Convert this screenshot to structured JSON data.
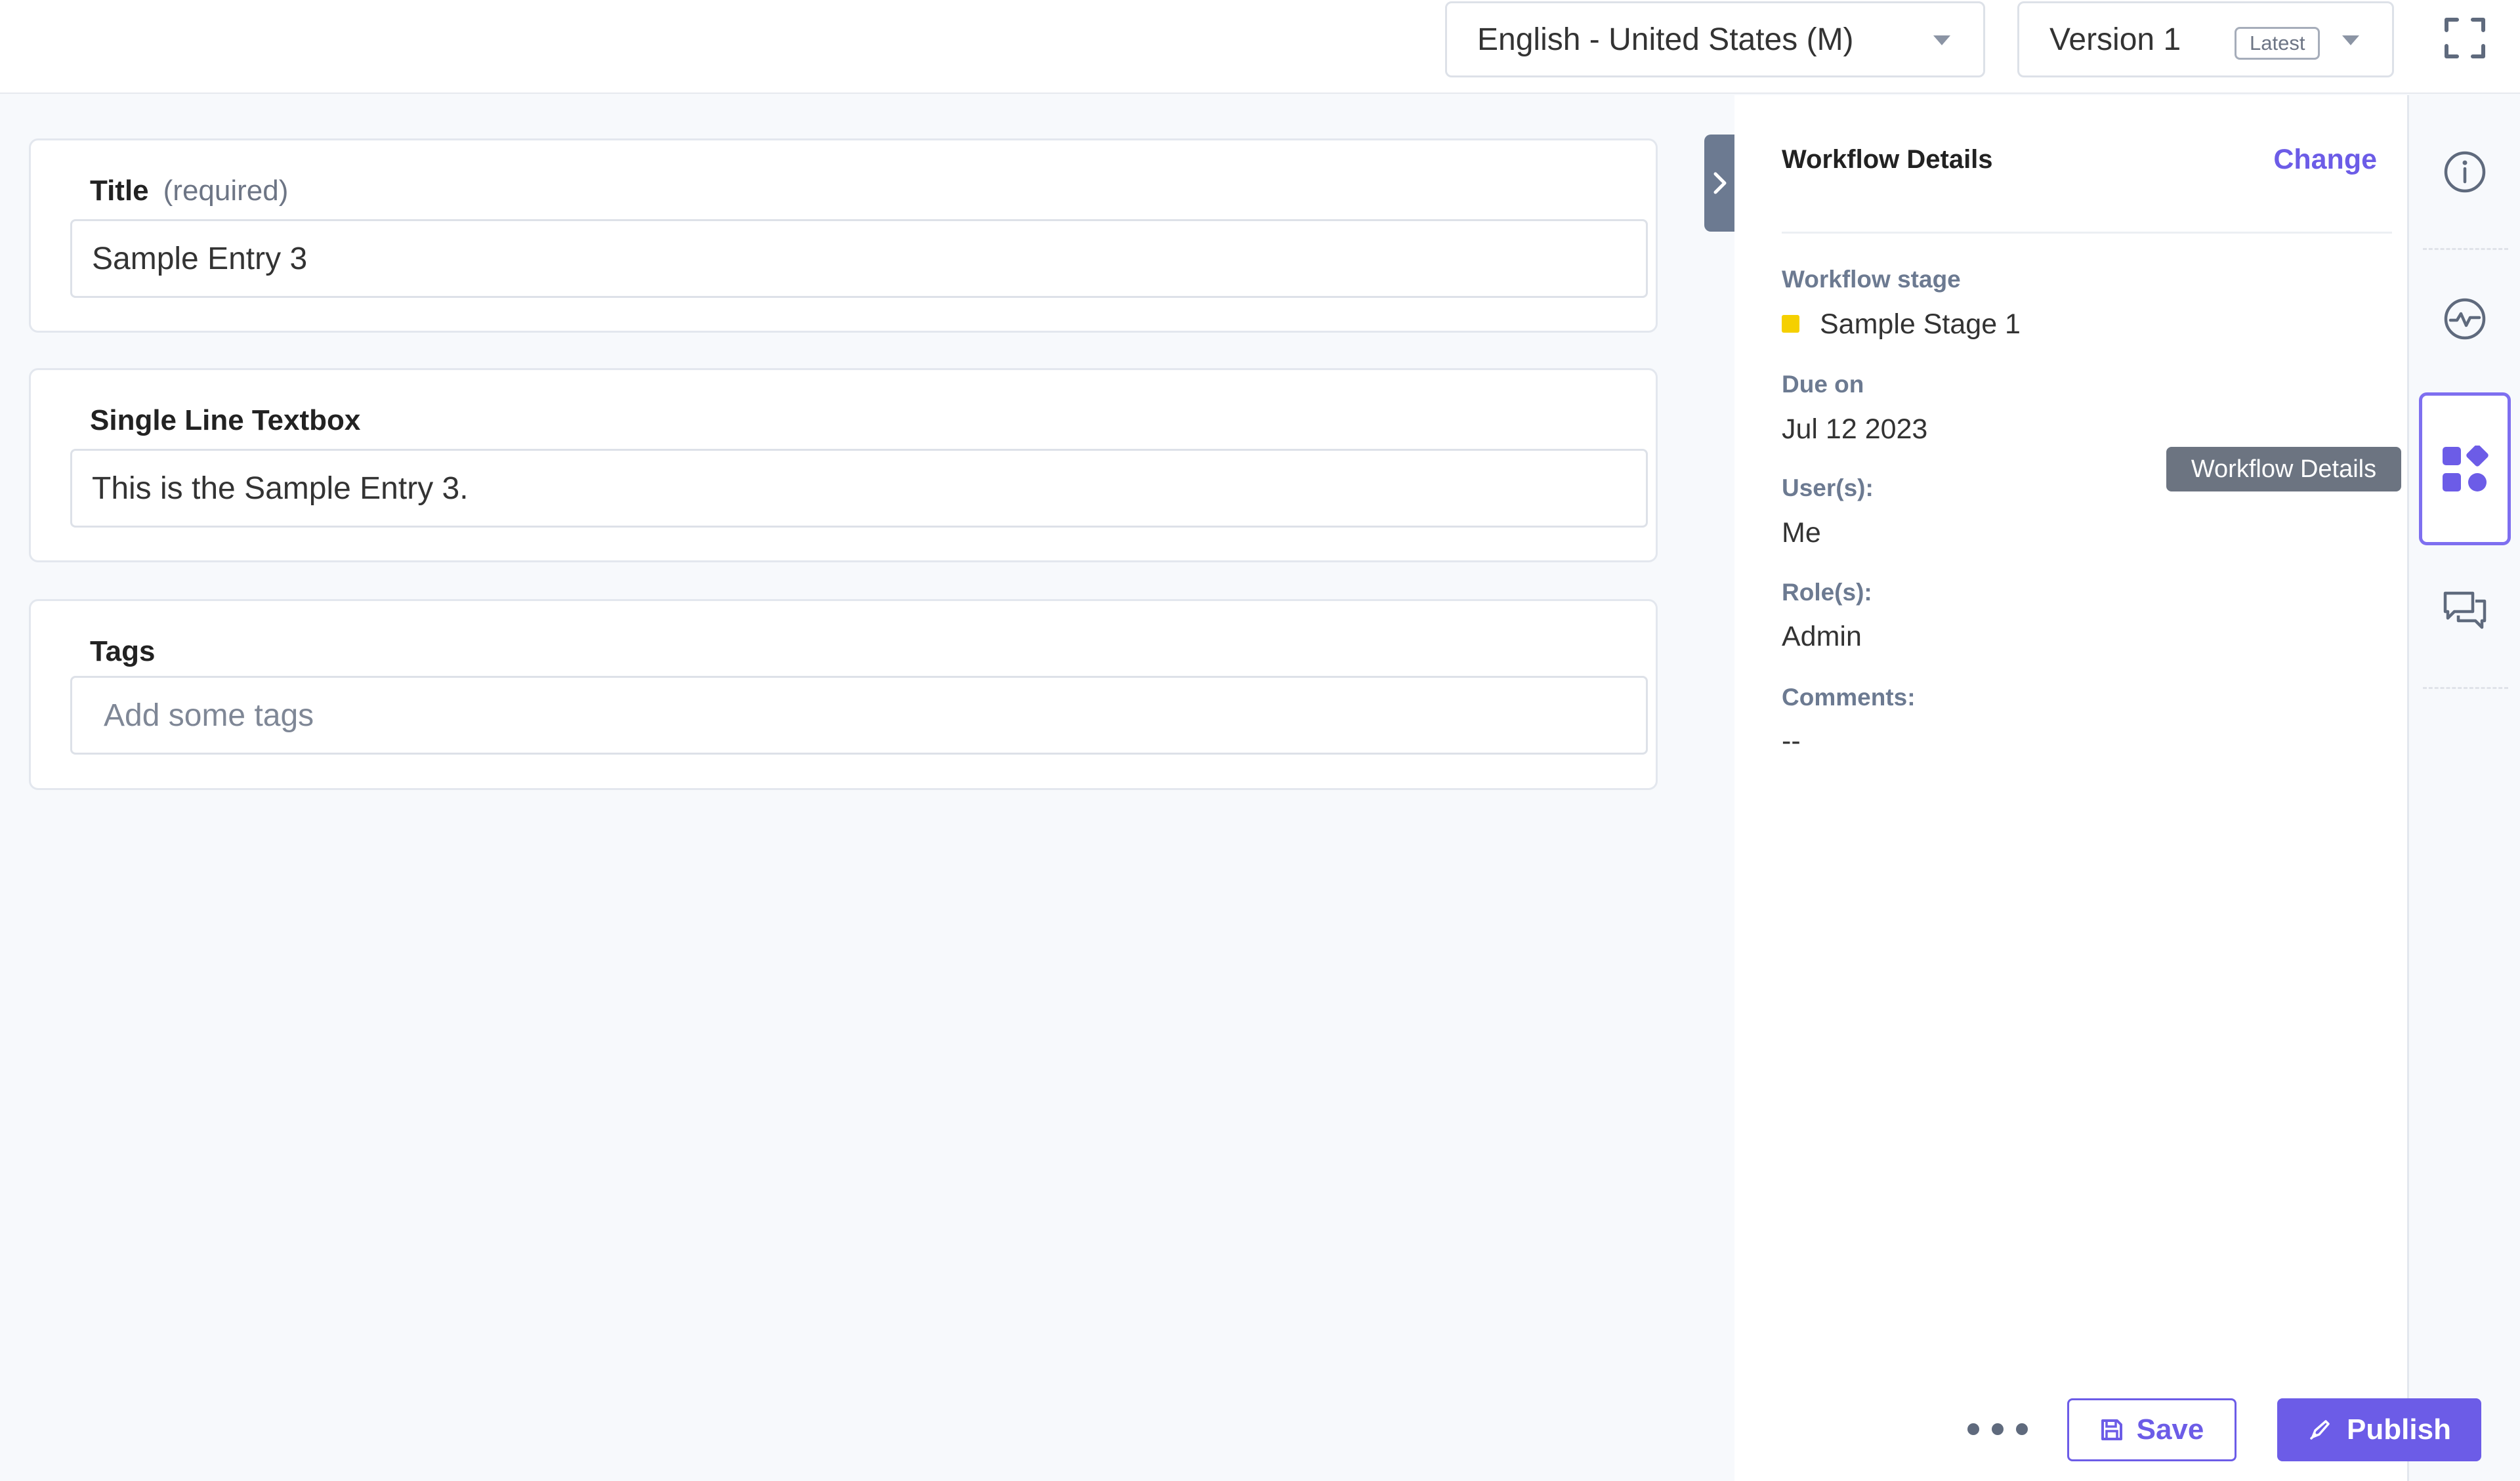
{
  "topbar": {
    "locale": "English - United States (M)",
    "version": "Version 1",
    "version_badge": "Latest"
  },
  "form": {
    "title_field": {
      "label": "Title",
      "hint": "(required)",
      "value": "Sample Entry 3"
    },
    "single_line_field": {
      "label": "Single Line Textbox",
      "value": "This is the Sample Entry 3."
    },
    "tags_field": {
      "label": "Tags",
      "placeholder": "Add some tags"
    }
  },
  "workflow_panel": {
    "title": "Workflow Details",
    "change_label": "Change",
    "stage_label": "Workflow stage",
    "stage_value": "Sample Stage 1",
    "stage_color": "#f5d000",
    "due_label": "Due on",
    "due_value": "Jul 12 2023",
    "users_label": "User(s):",
    "users_value": "Me",
    "roles_label": "Role(s):",
    "roles_value": "Admin",
    "comments_label": "Comments:",
    "comments_value": "--"
  },
  "tooltip": "Workflow Details",
  "footer": {
    "save_label": "Save",
    "publish_label": "Publish"
  },
  "icons": [
    "fullscreen-icon",
    "info-icon",
    "activity-icon",
    "workflow-icon",
    "comments-icon",
    "save-icon",
    "publish-icon",
    "chevron-right-icon"
  ],
  "colors": {
    "accent": "#6c5ce7",
    "stage": "#f5d000"
  }
}
